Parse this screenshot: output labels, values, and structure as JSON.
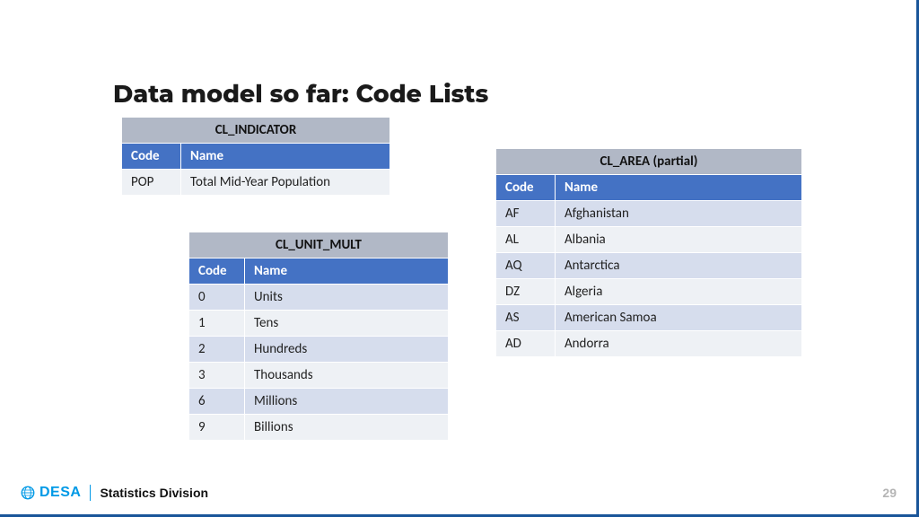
{
  "title": "Data model so far: Code Lists",
  "tables": {
    "indicator": {
      "caption": "CL_INDICATOR",
      "headers": {
        "code": "Code",
        "name": "Name"
      },
      "rows": [
        {
          "code": "POP",
          "name": "Total Mid-Year Population"
        }
      ]
    },
    "unit_mult": {
      "caption": "CL_UNIT_MULT",
      "headers": {
        "code": "Code",
        "name": "Name"
      },
      "rows": [
        {
          "code": "0",
          "name": "Units"
        },
        {
          "code": "1",
          "name": "Tens"
        },
        {
          "code": "2",
          "name": "Hundreds"
        },
        {
          "code": "3",
          "name": "Thousands"
        },
        {
          "code": "6",
          "name": "Millions"
        },
        {
          "code": "9",
          "name": "Billions"
        }
      ]
    },
    "area": {
      "caption": "CL_AREA (partial)",
      "headers": {
        "code": "Code",
        "name": "Name"
      },
      "rows": [
        {
          "code": "AF",
          "name": "Afghanistan"
        },
        {
          "code": "AL",
          "name": "Albania"
        },
        {
          "code": "AQ",
          "name": "Antarctica"
        },
        {
          "code": "DZ",
          "name": "Algeria"
        },
        {
          "code": "AS",
          "name": "American Samoa"
        },
        {
          "code": "AD",
          "name": "Andorra"
        }
      ]
    }
  },
  "footer": {
    "org": "DESA",
    "division": "Statistics Division",
    "page": "29"
  }
}
